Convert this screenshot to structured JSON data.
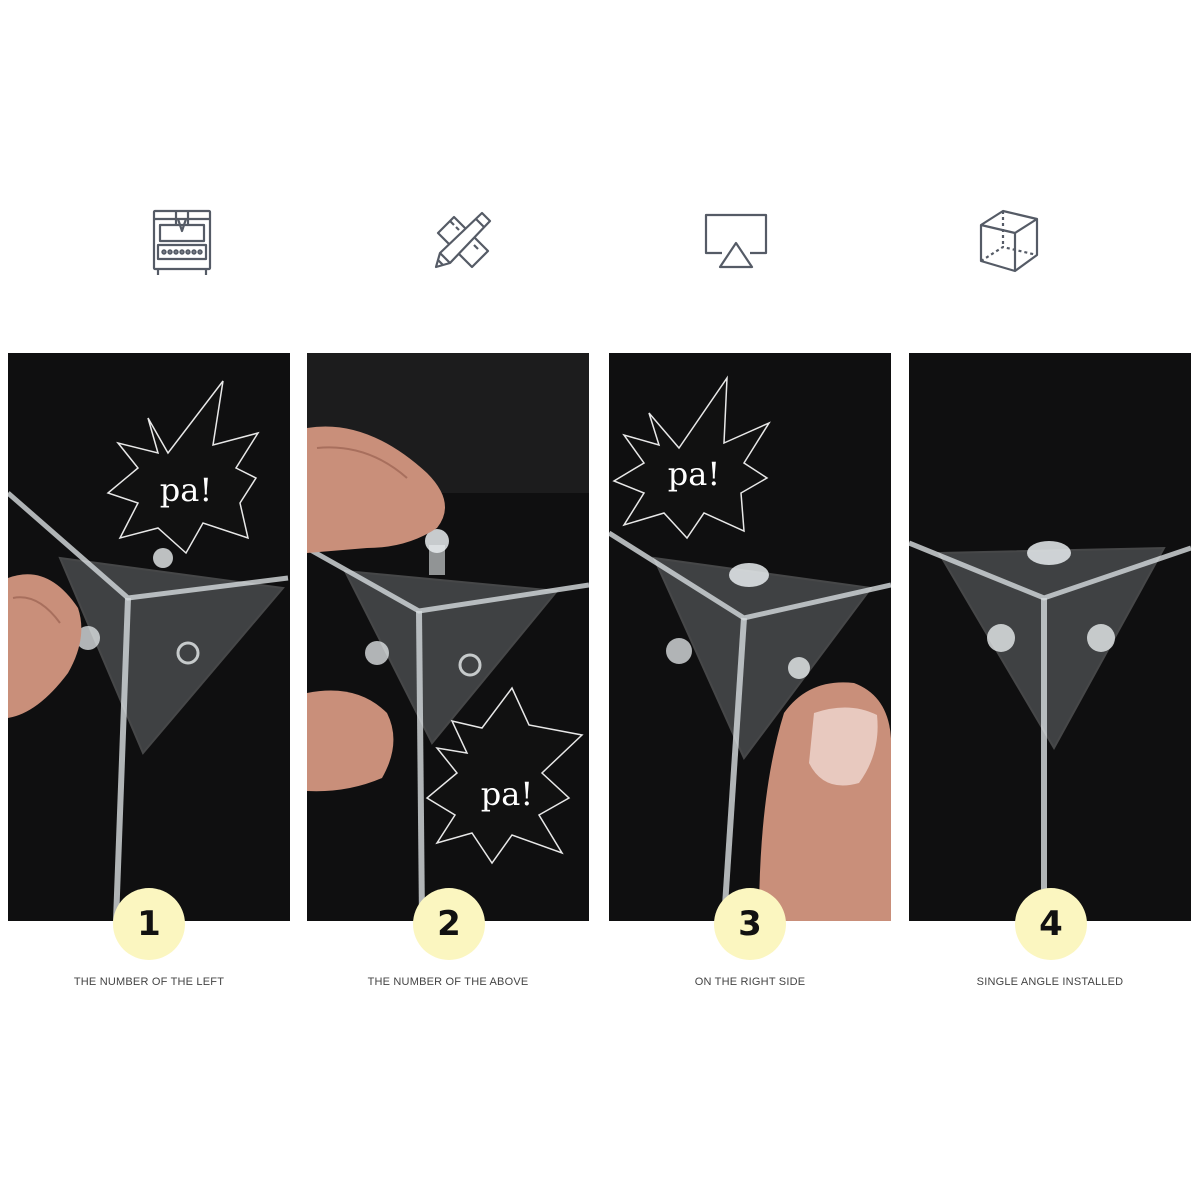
{
  "icons": [
    {
      "name": "machine-icon"
    },
    {
      "name": "pencil-ruler-icon"
    },
    {
      "name": "airplay-screen-icon"
    },
    {
      "name": "cube-icon"
    }
  ],
  "colors": {
    "panel_background": "#0f0f10",
    "step_circle": "#fbf6c0",
    "caption_text": "#444444",
    "icon_stroke": "#555b66"
  },
  "steps": [
    {
      "number": "1",
      "caption": "THE NUMBER OF THE LEFT",
      "bubble_text": "pa!"
    },
    {
      "number": "2",
      "caption": "THE NUMBER OF THE ABOVE",
      "bubble_text": "pa!"
    },
    {
      "number": "3",
      "caption": "ON THE RIGHT SIDE",
      "bubble_text": "pa!"
    },
    {
      "number": "4",
      "caption": "SINGLE ANGLE INSTALLED",
      "bubble_text": ""
    }
  ]
}
